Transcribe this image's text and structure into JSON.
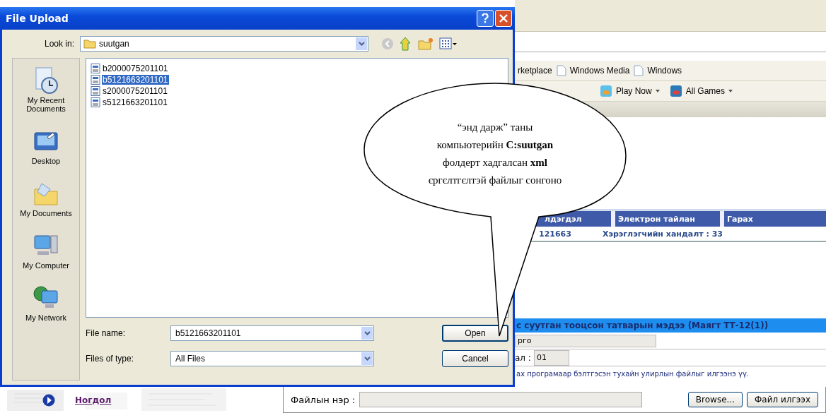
{
  "dialog": {
    "title": "File Upload",
    "look_in": {
      "label": "Look in:",
      "value": "suutgan"
    },
    "places": [
      {
        "label": "My Recent Documents",
        "kind": "recent"
      },
      {
        "label": "Desktop",
        "kind": "desktop"
      },
      {
        "label": "My Documents",
        "kind": "documents"
      },
      {
        "label": "My Computer",
        "kind": "computer"
      },
      {
        "label": "My Network",
        "kind": "network"
      }
    ],
    "files": [
      {
        "name": "b2000075201101",
        "selected": false
      },
      {
        "name": "b5121663201101",
        "selected": true
      },
      {
        "name": "s2000075201101",
        "selected": false
      },
      {
        "name": "s5121663201101",
        "selected": false
      }
    ],
    "file_name": {
      "label": "File name:",
      "value": "b5121663201101"
    },
    "file_type": {
      "label": "Files of type:",
      "value": "All Files"
    },
    "buttons": [
      "Open",
      "Cancel"
    ]
  },
  "callout": {
    "lines": [
      "“энд дарж” таны",
      "компьютерийн **C:suutgan**",
      "фолдерт хадгалсан **xml**",
      "єргєлтгєлтэй  файлыг сонгоно"
    ]
  },
  "browser": {
    "links": [
      "rketplace",
      "Windows Media",
      "Windows"
    ],
    "games": [
      "Play Now",
      "All Games"
    ]
  },
  "page": {
    "tabs": [
      "лдэгдэл",
      "Электрон тайлан",
      "Гарах"
    ],
    "info": [
      "121663",
      "Хэрэглэгчийн хандалт : 33"
    ],
    "form_title": "с суутган тооцсон татварын мэдээ (Маягт ТТ-12(1))",
    "field_1": {
      "value": "рго"
    },
    "field_2": {
      "label": "ал :",
      "value": "01"
    },
    "note": "ах програмаар бэлтгэсэн тухайн улирлын файлыг илгээнэ үү.",
    "upload": {
      "label": "Файлын нэр :",
      "browse": "Browse...",
      "send": "Файл илгээх"
    },
    "side_link": "Ногдол"
  }
}
